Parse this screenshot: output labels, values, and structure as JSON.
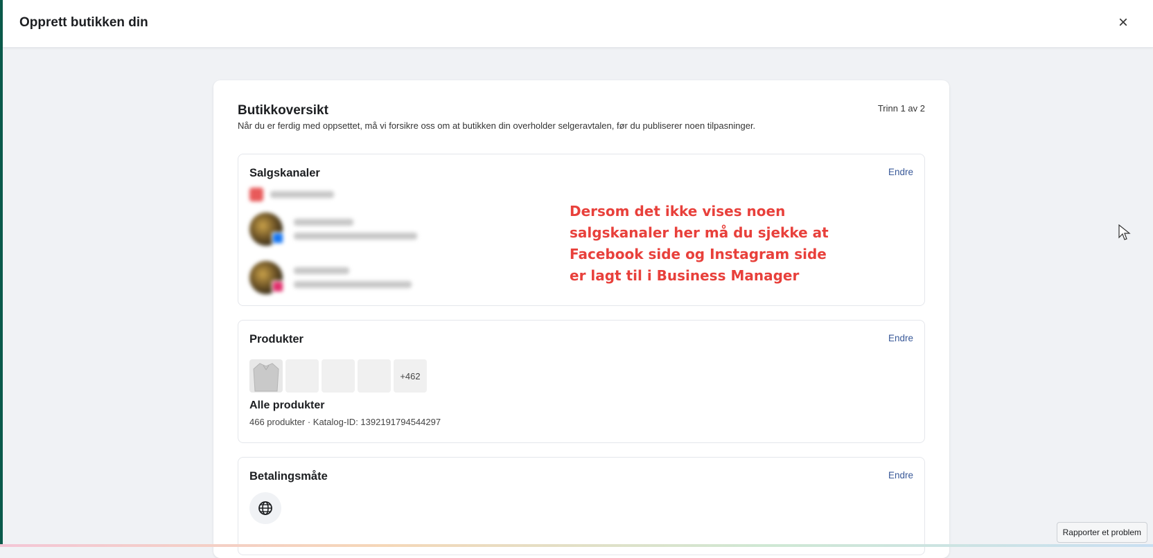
{
  "header": {
    "title": "Opprett butikken din",
    "close_icon": "×"
  },
  "overview": {
    "title": "Butikkoversikt",
    "subtitle": "Når du er ferdig med oppsettet, må vi forsikre oss om at butikken din overholder selgeravtalen, før du publiserer noen tilpasninger.",
    "step": "Trinn 1 av 2"
  },
  "sections": {
    "sales_channels": {
      "title": "Salgskanaler",
      "edit_label": "Endre",
      "channels": [
        {
          "platform": "facebook",
          "badge_color": "#1877f2"
        },
        {
          "platform": "instagram",
          "badge_color": "#e1306c"
        }
      ]
    },
    "products": {
      "title": "Produkter",
      "edit_label": "Endre",
      "more_count": "+462",
      "name": "Alle produkter",
      "meta": "466 produkter · Katalog-ID: 1392191794544297"
    },
    "payment": {
      "title": "Betalingsmåte",
      "edit_label": "Endre",
      "icon": "globe-icon"
    }
  },
  "annotation": {
    "text": "Dersom det ikke vises noen salgskanaler her må du sjekke at Facebook side og Instagram side er lagt til i Business Manager",
    "color": "#e8403b"
  },
  "footer": {
    "report_label": "Rapporter et problem"
  },
  "colors": {
    "link": "#385898",
    "background": "#f0f2f5",
    "left_edge": "#0b5a4b"
  }
}
